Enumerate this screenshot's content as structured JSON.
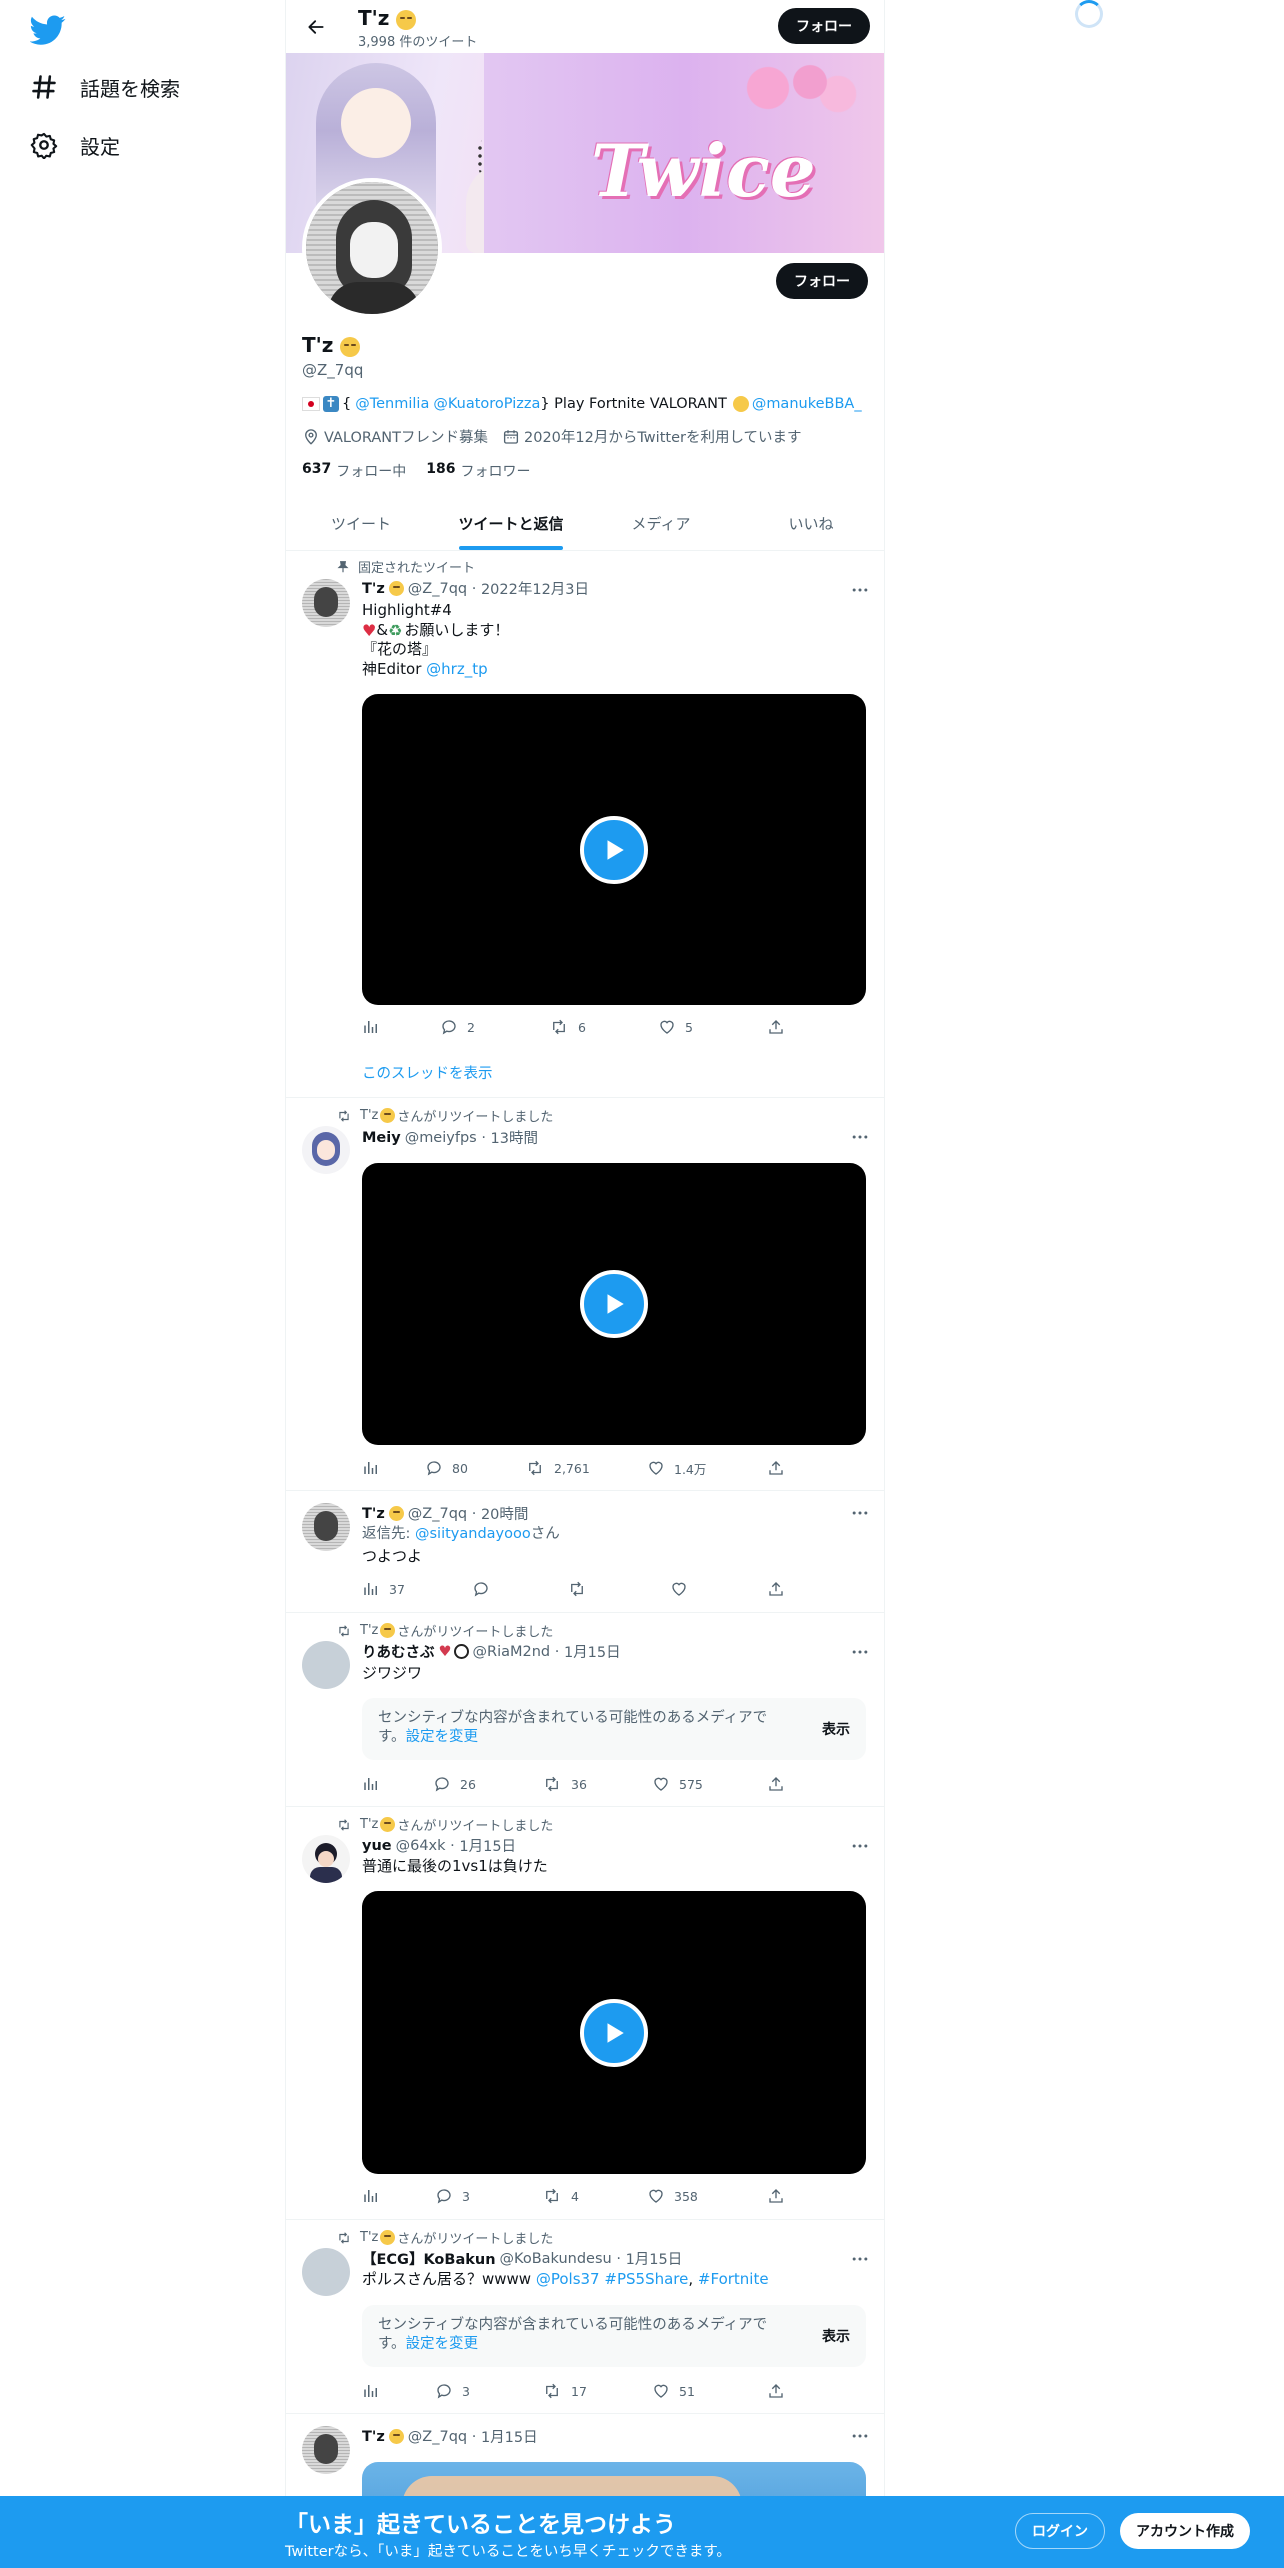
{
  "nav": {
    "logo": "twitter-logo",
    "items": [
      {
        "icon": "hashtag-icon",
        "label": "話題を検索"
      },
      {
        "icon": "gear-icon",
        "label": "設定"
      }
    ]
  },
  "header": {
    "name": "T'z",
    "tweet_count": "3,998 件のツイート",
    "follow_label": "フォロー"
  },
  "banner": {
    "text": "Twice"
  },
  "profile": {
    "name": "T'z",
    "handle": "@Z_7qq",
    "bio_open": "{",
    "bio_mention1": "@Tenmilia",
    "bio_mention2": "@KuatoroPizza",
    "bio_mid": "} Play Fortnite VALORANT",
    "bio_mention3": "@manukeBBA_",
    "location": "VALORANTフレンド募集",
    "joined": "2020年12月からTwitterを利用しています",
    "following_count": "637",
    "following_label": "フォロー中",
    "followers_count": "186",
    "followers_label": "フォロワー",
    "follow_label": "フォロー"
  },
  "tabs": [
    "ツイート",
    "ツイートと返信",
    "メディア",
    "いいね"
  ],
  "tweets": [
    {
      "context": "固定されたツイート",
      "name": "T'z",
      "handle": "@Z_7qq",
      "time": "2022年12月3日",
      "line1": "Highlight#4",
      "line2": "お願いします！",
      "line3": "『花の塔』",
      "line4_prefix": "神Editor ",
      "line4_link": "@hrz_tp",
      "replies": "2",
      "retweets": "6",
      "likes": "5",
      "thread_link": "このスレッドを表示"
    },
    {
      "context": "さんがリツイートしました",
      "name": "Meiy",
      "handle": "@meiyfps",
      "time": "13時間",
      "replies": "80",
      "retweets": "2,761",
      "likes": "1.4万"
    },
    {
      "name": "T'z",
      "handle": "@Z_7qq",
      "time": "20時間",
      "reply_prefix": "返信先: ",
      "reply_to": "@siityandayooo",
      "reply_suffix": "さん",
      "text": "つよつよ",
      "views": "37"
    },
    {
      "context": "さんがリツイートしました",
      "name": "りあむさぶ",
      "handle": "@RiaM2nd",
      "time": "1月15日",
      "text": "ジワジワ",
      "sensitive": "センシティブな内容が含まれている可能性のあるメディアです。",
      "sensitive_link": "設定を変更",
      "show_label": "表示",
      "replies": "26",
      "retweets": "36",
      "likes": "575"
    },
    {
      "context": "さんがリツイートしました",
      "name": "yue",
      "handle": "@64xk",
      "time": "1月15日",
      "text": "普通に最後の1vs1は負けた",
      "replies": "3",
      "retweets": "4",
      "likes": "358"
    },
    {
      "context": "さんがリツイートしました",
      "name": "【ECG】KoBakun",
      "handle": "@KoBakundesu",
      "time": "1月15日",
      "text_prefix": "ポルスさん居る？wwww ",
      "text_link1": "@Pols37",
      "text_link2": "#PS5Share",
      "text_link3": "#Fortnite",
      "sensitive": "センシティブな内容が含まれている可能性のあるメディアです。",
      "sensitive_link": "設定を変更",
      "show_label": "表示",
      "replies": "3",
      "retweets": "17",
      "likes": "51"
    },
    {
      "name": "T'z",
      "handle": "@Z_7qq",
      "time": "1月15日"
    }
  ],
  "bottom_bar": {
    "title": "「いま」起きていることを見つけよう",
    "subtitle": "Twitterなら、「いま」起きていることをいち早くチェックできます。",
    "login": "ログイン",
    "signup": "アカウント作成"
  },
  "colors": {
    "accent": "#1d9bf0",
    "text": "#0f1419",
    "muted": "#536471"
  }
}
